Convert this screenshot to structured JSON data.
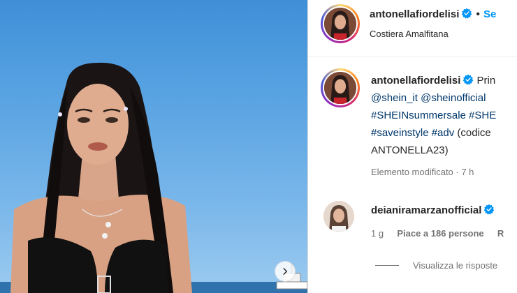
{
  "header": {
    "username": "antonellafiordelisi",
    "separator": "•",
    "follow_label": "Se",
    "location": "Costiera Amalfitana"
  },
  "caption": {
    "username": "antonellafiordelisi",
    "first_line_text": "Prin",
    "mention_1": "@shein_it",
    "mention_2": "@sheinofficial",
    "hashtag_1": "#SHEINsummersale",
    "hashtag_2": "#SHE",
    "hashtag_3": "#saveinstyle",
    "hashtag_4": "#adv",
    "text_after": "(codice",
    "last_line": "ANTONELLA23)",
    "meta": "Elemento modificato · 7 h"
  },
  "comment": {
    "username": "deianiramarzanofficial",
    "time": "1 g",
    "likes": "Piace a 186 persone",
    "reply_partial": "R",
    "view_replies": "Visualizza le risposte"
  },
  "colors": {
    "link": "#0095f6",
    "tag": "#00376b",
    "muted": "#737373",
    "verified": "#0095f6"
  },
  "icons": {
    "next": "chevron-right-icon",
    "verified": "verified-badge-icon"
  }
}
